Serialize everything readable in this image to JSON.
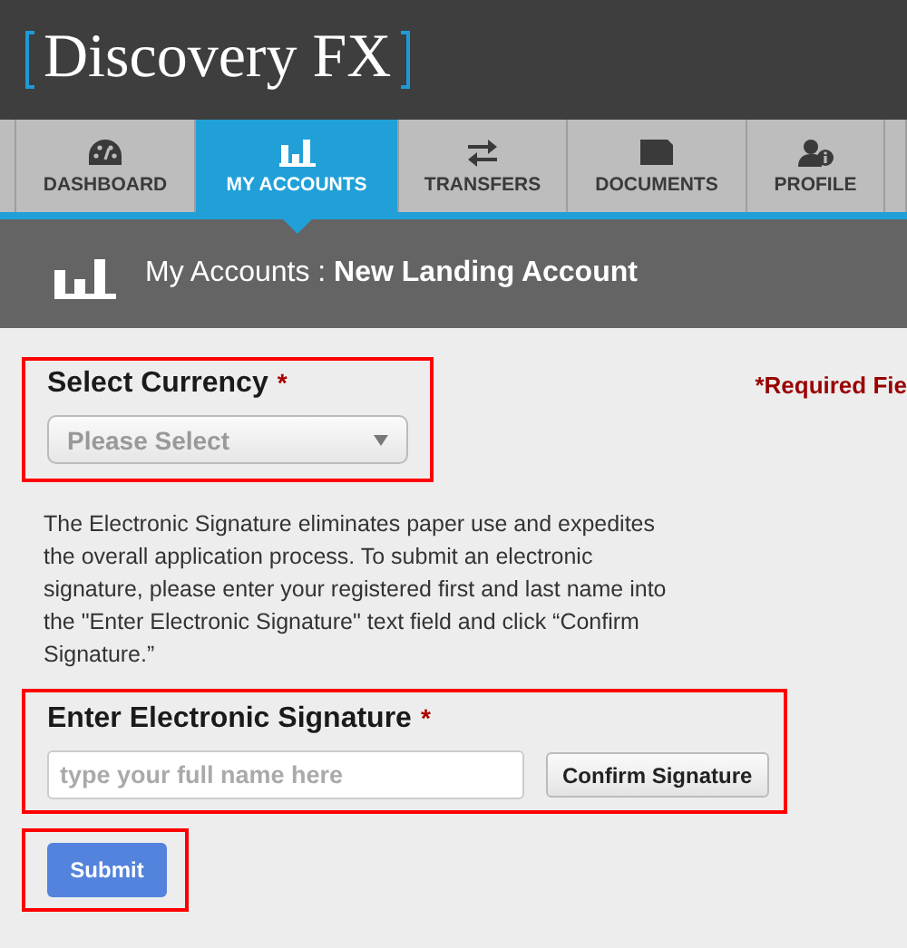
{
  "logo": {
    "text": "Discovery FX"
  },
  "tabs": [
    {
      "label": "DASHBOARD",
      "selected": false
    },
    {
      "label": "MY ACCOUNTS",
      "selected": true
    },
    {
      "label": "TRANSFERS",
      "selected": false
    },
    {
      "label": "DOCUMENTS",
      "selected": false
    },
    {
      "label": "PROFILE",
      "selected": false
    }
  ],
  "page_header": {
    "section": "My Accounts :",
    "title": "New Landing Account"
  },
  "required_note": "*Required Fie",
  "currency": {
    "label": "Select Currency",
    "mark": "*",
    "placeholder": "Please Select",
    "highlighted": true
  },
  "description": "The Electronic Signature eliminates paper use and expedites the overall application process. To submit an electronic signature, please enter your registered first and last name into the \"Enter Electronic Signature\" text field and click “Confirm Signature.”",
  "signature": {
    "label": "Enter Electronic Signature",
    "mark": "*",
    "placeholder": "type your full name here",
    "button": "Confirm Signature",
    "highlighted": true
  },
  "submit": {
    "label": "Submit",
    "highlighted": true
  }
}
